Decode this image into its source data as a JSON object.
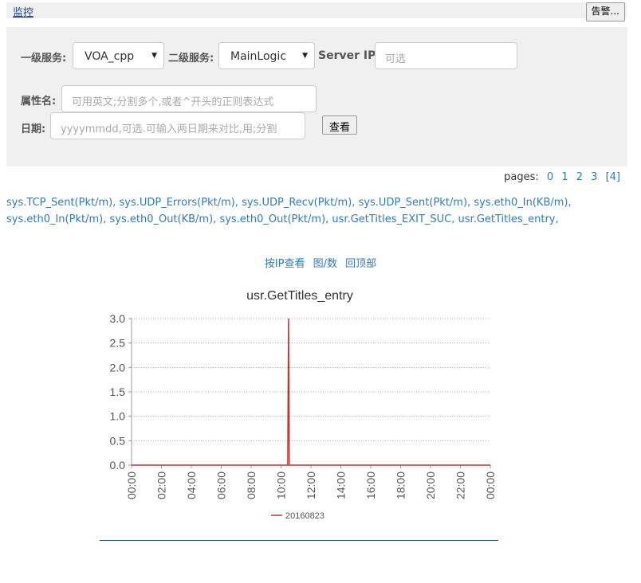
{
  "header": {
    "title": "监控",
    "alert_button": "告警..."
  },
  "filters": {
    "service1_label": "一级服务:",
    "service1_value": "VOA_cpp",
    "service2_label": "二级服务:",
    "service2_value": "MainLogic",
    "server_ip_label": "Server IP:",
    "server_ip_placeholder": "可选",
    "attr_label": "属性名:",
    "attr_placeholder": "可用英文;分割多个,或者^开头的正则表达式",
    "date_label": "日期:",
    "date_placeholder": "yyyymmdd,可选.可输入两日期来对比,用;分割",
    "query_button": "查看"
  },
  "pagination": {
    "label": "pages:",
    "pages": [
      "0",
      "1",
      "2",
      "3",
      "[4]"
    ]
  },
  "metrics": [
    "sys.TCP_Sent(Pkt/m),",
    "sys.UDP_Errors(Pkt/m),",
    "sys.UDP_Recv(Pkt/m),",
    "sys.UDP_Sent(Pkt/m),",
    "sys.eth0_In(KB/m),",
    "sys.eth0_In(Pkt/m),",
    "sys.eth0_Out(KB/m),",
    "sys.eth0_Out(Pkt/m),",
    "usr.GetTitles_EXIT_SUC,",
    "usr.GetTitles_entry,"
  ],
  "links": {
    "by_ip": "按IP查看",
    "chart_number": "图/数",
    "back_top": "回顶部"
  },
  "chart_data": {
    "type": "line",
    "title": "usr.GetTitles_entry",
    "x_ticks": [
      "00:00",
      "02:00",
      "04:00",
      "06:00",
      "08:00",
      "10:00",
      "12:00",
      "14:00",
      "16:00",
      "18:00",
      "20:00",
      "22:00",
      "00:00"
    ],
    "y_ticks": [
      "0.0",
      "0.5",
      "1.0",
      "1.5",
      "2.0",
      "2.5",
      "3.0"
    ],
    "ylim": [
      0,
      3
    ],
    "xlim_hours": [
      0,
      24
    ],
    "grid": true,
    "legend_position": "bottom",
    "series": [
      {
        "name": "20160823",
        "color": "#c23531",
        "points": [
          [
            0,
            0
          ],
          [
            10.45,
            0
          ],
          [
            10.5,
            3
          ],
          [
            10.55,
            0
          ],
          [
            24,
            0
          ]
        ]
      }
    ]
  }
}
